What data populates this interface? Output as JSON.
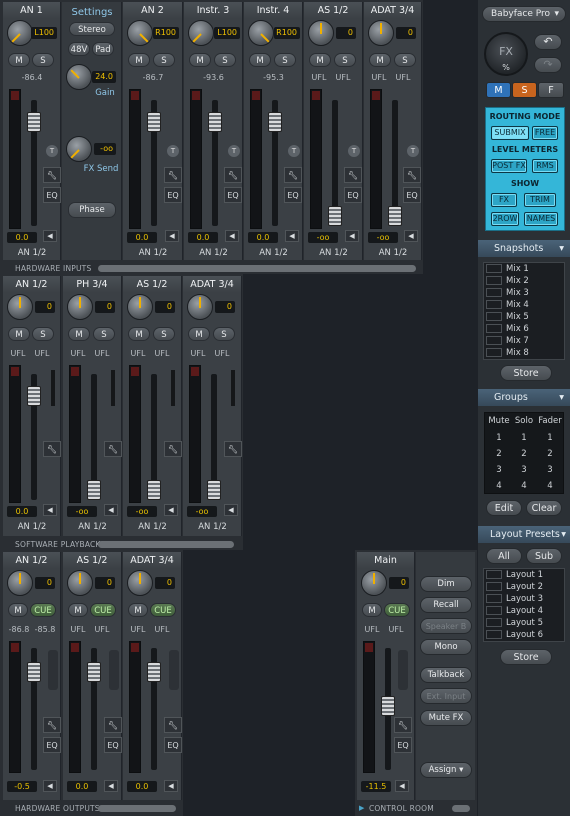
{
  "hardware_inputs": {
    "section_label": "HARDWARE INPUTS",
    "settings": {
      "title": "Settings",
      "stereo": "Stereo",
      "phantom": "48V",
      "pad": "Pad",
      "gain_value": "24.0",
      "gain_label": "Gain",
      "fxsend_value": "-oo",
      "fxsend_label": "FX Send",
      "phase": "Phase"
    },
    "channels": [
      {
        "name": "AN 1",
        "pan": "L100",
        "level": "-86.4",
        "fader": "0.0",
        "route": "AN 1/2",
        "labels": [
          "",
          ""
        ]
      },
      {
        "name": "AN 2",
        "pan": "R100",
        "level": "-86.7",
        "fader": "0.0",
        "route": "AN 1/2",
        "labels": [
          "",
          ""
        ]
      },
      {
        "name": "Instr. 3",
        "pan": "L100",
        "level": "-93.6",
        "fader": "0.0",
        "route": "AN 1/2",
        "labels": [
          "",
          ""
        ]
      },
      {
        "name": "Instr. 4",
        "pan": "R100",
        "level": "-95.3",
        "fader": "0.0",
        "route": "AN 1/2",
        "labels": [
          "",
          ""
        ]
      },
      {
        "name": "AS 1/2",
        "pan": "0",
        "level": "",
        "fader": "-oo",
        "route": "AN 1/2",
        "labels": [
          "UFL",
          "UFL"
        ]
      },
      {
        "name": "ADAT 3/4",
        "pan": "0",
        "level": "",
        "fader": "-oo",
        "route": "AN 1/2",
        "labels": [
          "UFL",
          "UFL"
        ]
      }
    ]
  },
  "software_playback": {
    "section_label": "SOFTWARE PLAYBACK",
    "channels": [
      {
        "name": "AN 1/2",
        "pan": "0",
        "fader": "0.0",
        "route": "AN 1/2",
        "labels": [
          "UFL",
          "UFL"
        ]
      },
      {
        "name": "PH 3/4",
        "pan": "0",
        "fader": "-oo",
        "route": "AN 1/2",
        "labels": [
          "UFL",
          "UFL"
        ]
      },
      {
        "name": "AS 1/2",
        "pan": "0",
        "fader": "-oo",
        "route": "AN 1/2",
        "labels": [
          "UFL",
          "UFL"
        ]
      },
      {
        "name": "ADAT 3/4",
        "pan": "0",
        "fader": "-oo",
        "route": "AN 1/2",
        "labels": [
          "UFL",
          "UFL"
        ]
      }
    ]
  },
  "hardware_outputs": {
    "section_label": "HARDWARE OUTPUTS",
    "channels": [
      {
        "name": "AN 1/2",
        "pan": "0",
        "levels": [
          "-86.8",
          "-85.8"
        ],
        "fader": "-0.5"
      },
      {
        "name": "AS 1/2",
        "pan": "0",
        "levels": [
          "UFL",
          "UFL"
        ],
        "fader": "0.0"
      },
      {
        "name": "ADAT 3/4",
        "pan": "0",
        "levels": [
          "UFL",
          "UFL"
        ],
        "fader": "0.0"
      }
    ],
    "m_label": "M",
    "cue_label": "CUE",
    "eq_label": "EQ"
  },
  "control_room": {
    "section_label": "CONTROL ROOM",
    "main": {
      "name": "Main",
      "pan": "0",
      "levels": [
        "UFL",
        "UFL"
      ],
      "fader": "-11.5"
    },
    "buttons": [
      "Dim",
      "Recall",
      "Speaker B",
      "Mono",
      "Talkback",
      "Ext. Input",
      "Mute FX",
      "Assign"
    ]
  },
  "common": {
    "m": "M",
    "s": "S",
    "t": "T",
    "eq": "EQ",
    "zero": "0"
  },
  "side": {
    "device": "Babyface Pro",
    "fx_label": "FX",
    "fx_percent": "%",
    "mode_buttons": [
      "M",
      "S",
      "F"
    ],
    "routing_title": "ROUTING MODE",
    "routing": [
      "SUBMIX",
      "FREE"
    ],
    "meters_title": "LEVEL METERS",
    "meters": [
      "POST FX",
      "RMS"
    ],
    "show_title": "SHOW",
    "show": [
      "FX",
      "TRIM",
      "2ROW",
      "NAMES"
    ],
    "snapshots_title": "Snapshots",
    "snapshots": [
      "Mix 1",
      "Mix 2",
      "Mix 3",
      "Mix 4",
      "Mix 5",
      "Mix 6",
      "Mix 7",
      "Mix 8"
    ],
    "store": "Store",
    "groups_title": "Groups",
    "group_headers": [
      "Mute",
      "Solo",
      "Fader"
    ],
    "group_rows": [
      [
        "1",
        "1",
        "1"
      ],
      [
        "2",
        "2",
        "2"
      ],
      [
        "3",
        "3",
        "3"
      ],
      [
        "4",
        "4",
        "4"
      ]
    ],
    "edit": "Edit",
    "clear": "Clear",
    "layout_title": "Layout Presets",
    "all": "All",
    "sub": "Sub",
    "layouts": [
      "Layout 1",
      "Layout 2",
      "Layout 3",
      "Layout 4",
      "Layout 5",
      "Layout 6"
    ],
    "colors": {
      "accent": "#34b6d8",
      "panel_title": "#4a6378",
      "knob_pointer": "#f0b000"
    }
  }
}
